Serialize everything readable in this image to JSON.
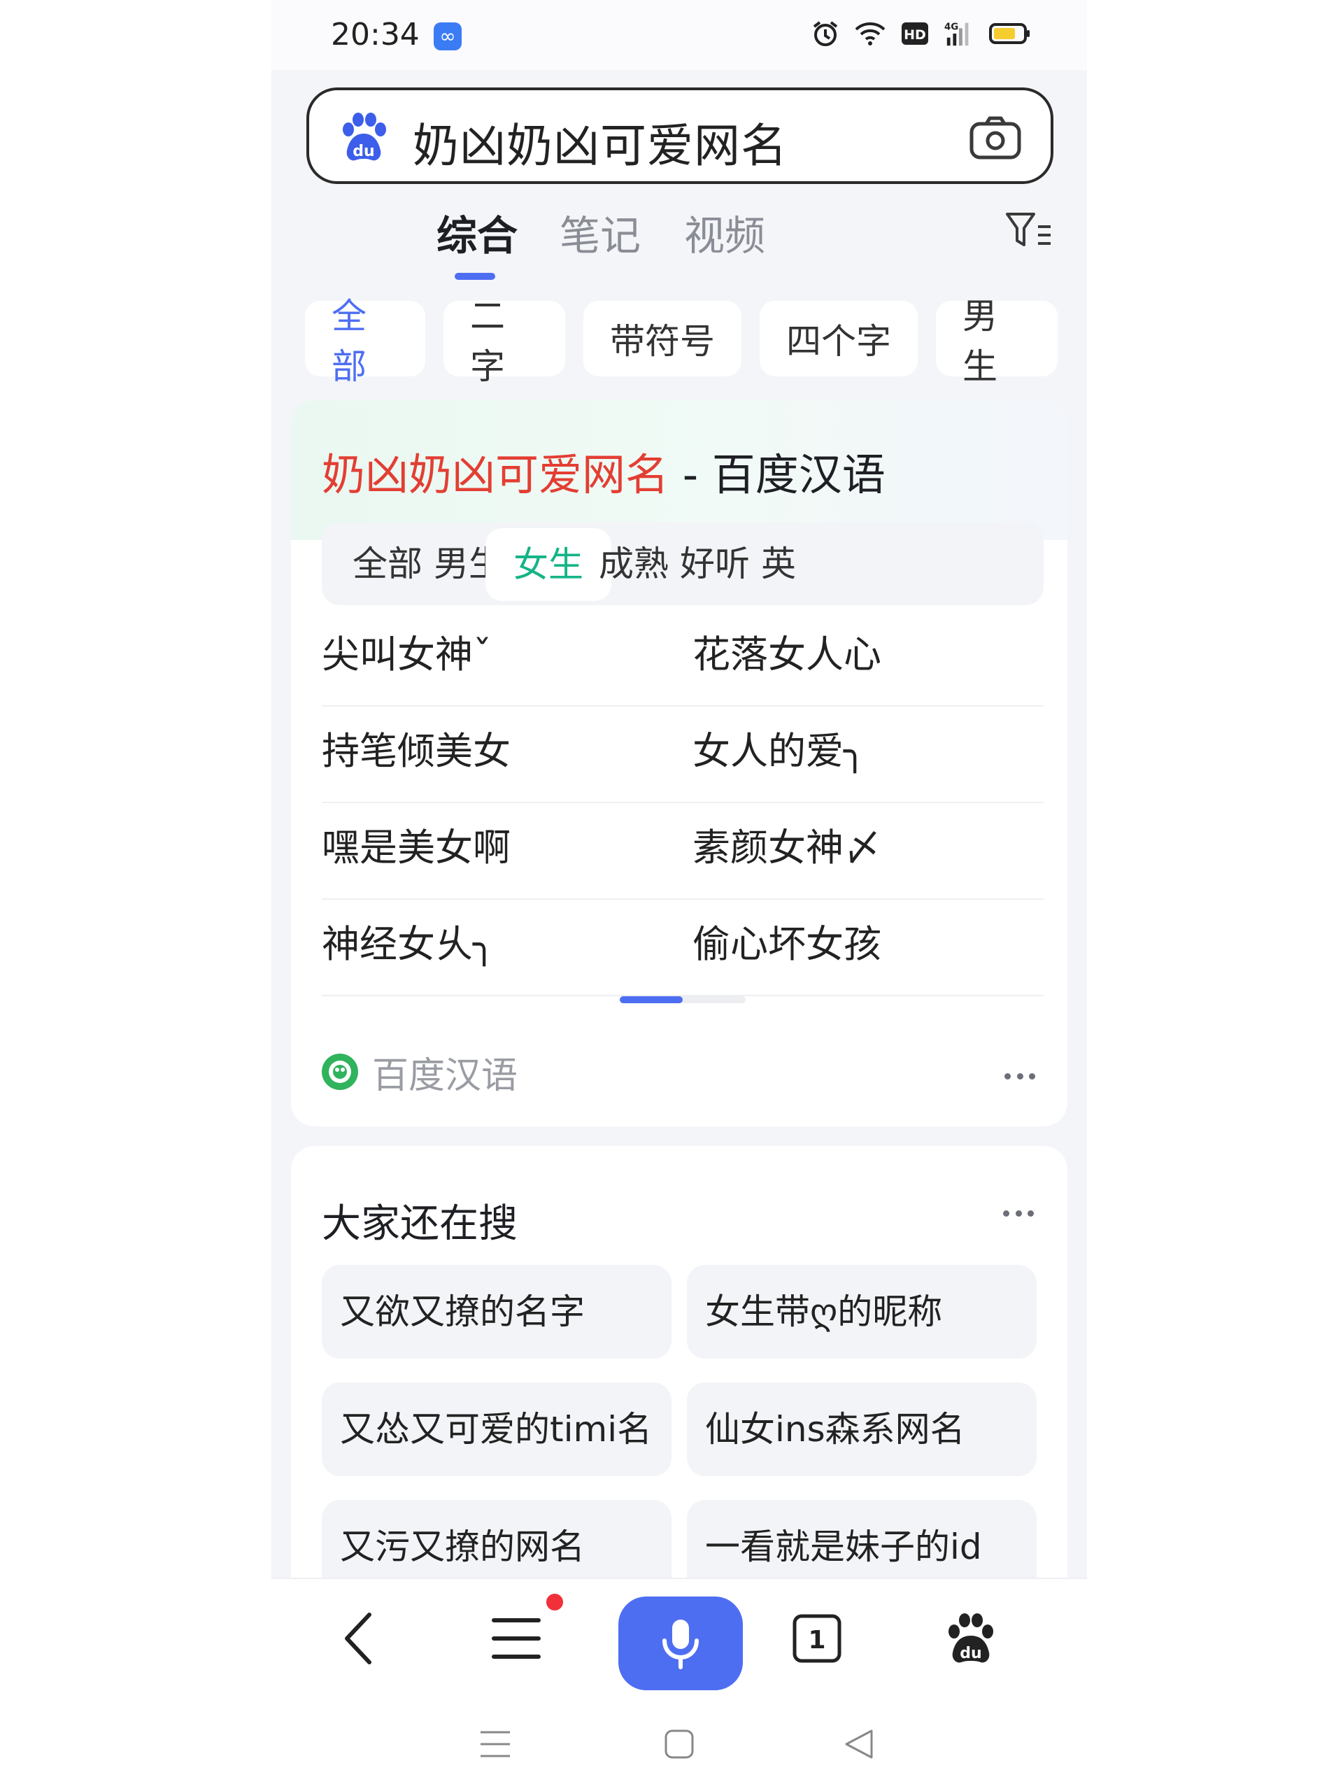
{
  "status_bar": {
    "time": "20:34",
    "app_badge_icon": "infinity-icon",
    "icons": [
      "alarm-icon",
      "wifi-icon",
      "hd-icon",
      "4g-signal-icon",
      "battery-icon"
    ],
    "hd_label": "HD",
    "network_label": "4G"
  },
  "search": {
    "query": "奶凶奶凶可爱网名",
    "logo_text": "du",
    "camera_icon": "camera-icon"
  },
  "main_tabs": {
    "items": [
      {
        "label": "综合",
        "active": true
      },
      {
        "label": "笔记",
        "active": false
      },
      {
        "label": "视频",
        "active": false
      }
    ],
    "filter_icon": "filter-icon"
  },
  "chips": {
    "items": [
      {
        "label": "全部",
        "active": true
      },
      {
        "label": "二字",
        "active": false
      },
      {
        "label": "带符号",
        "active": false
      },
      {
        "label": "四个字",
        "active": false
      },
      {
        "label": "男生",
        "active": false
      }
    ]
  },
  "result_card": {
    "title_highlight": "奶凶奶凶可爱网名",
    "title_rest": " - 百度汉语",
    "subtabs": [
      {
        "label": "全部",
        "active": false
      },
      {
        "label": "男生",
        "active": false
      },
      {
        "label": "女生",
        "active": true
      },
      {
        "label": "成熟",
        "active": false
      },
      {
        "label": "好听",
        "active": false
      },
      {
        "label": "英",
        "active": false
      }
    ],
    "names": [
      [
        "尖叫女神ˇ",
        "花落女人心"
      ],
      [
        "持笔倾美女",
        "女人的爱╮"
      ],
      [
        "嘿是美女啊",
        "素颜女神〆"
      ],
      [
        "神经女乆╮",
        "偷心坏女孩"
      ]
    ],
    "source_label": "百度汉语",
    "more_icon": "more-dots-icon",
    "scroll_progress": 0.5
  },
  "also_searched": {
    "title": "大家还在搜",
    "items": [
      "又欲又撩的名字",
      "女生带ღ的昵称",
      "又怂又可爱的timi名",
      "仙女ins森系网名",
      "又污又撩的网名",
      "一看就是妹子的id"
    ]
  },
  "bottom_nav": {
    "items": [
      "back-icon",
      "menu-icon",
      "microphone-icon",
      "tabs-icon",
      "baidu-paw-icon"
    ],
    "tab_count": "1",
    "menu_has_notification": true
  },
  "system_nav": {
    "items": [
      "recent-apps-icon",
      "home-icon",
      "back-triangle-icon"
    ]
  },
  "colors": {
    "accent_blue": "#4e6ef2",
    "highlight_red": "#e33e33",
    "active_green": "#15b487"
  }
}
